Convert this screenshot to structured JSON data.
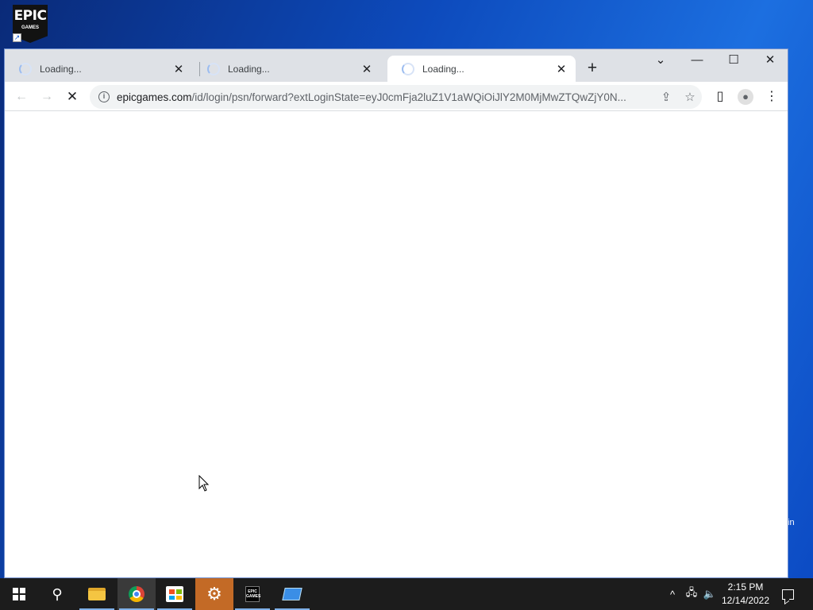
{
  "desktop": {
    "epic_icon": {
      "top": "EPIC",
      "bottom": "GAMES"
    },
    "partial_label": "in"
  },
  "browser": {
    "tabs": [
      {
        "title": "Loading...",
        "active": false
      },
      {
        "title": "Loading...",
        "active": false
      },
      {
        "title": "Loading...",
        "active": true
      }
    ],
    "address": {
      "host": "epicgames.com",
      "path": "/id/login/psn/forward?extLoginState=eyJ0cmFja2luZ1V1aWQiOiJlY2M0MjMwZTQwZjY0N..."
    }
  },
  "taskbar": {
    "time": "2:15 PM",
    "date": "12/14/2022",
    "epic_label": "EPIC GAMES"
  }
}
